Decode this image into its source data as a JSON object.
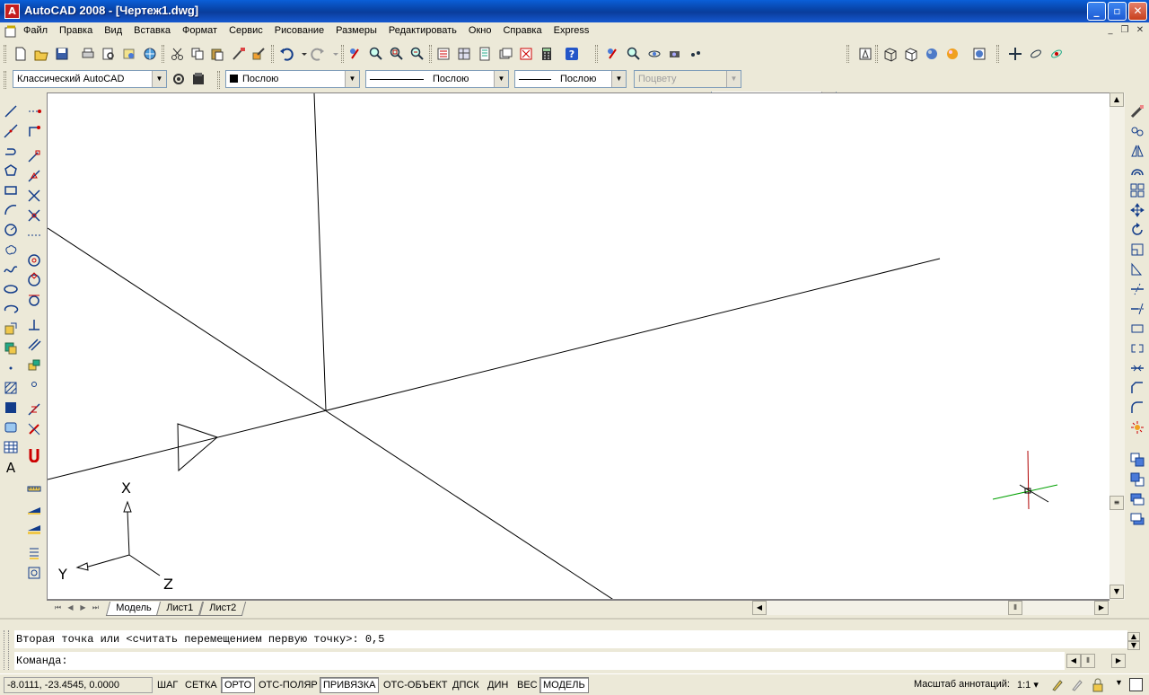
{
  "window": {
    "title": "AutoCAD 2008 - [Чертеж1.dwg]"
  },
  "menu": {
    "items": [
      "Файл",
      "Правка",
      "Вид",
      "Вставка",
      "Формат",
      "Сервис",
      "Рисование",
      "Размеры",
      "Редактировать",
      "Окно",
      "Справка",
      "Express"
    ]
  },
  "toolbar": {
    "workspace": "Классический AutoCAD",
    "color": "Послою",
    "linetype": "Послою",
    "lineweight": "Послою",
    "plotstyle": "Поцвету",
    "view_combo": ""
  },
  "viewport": {
    "ucs_x_label": "X",
    "ucs_y_label": "Y",
    "ucs_z_label": "Z",
    "crosshair_color": "#b00000",
    "crosshair_axis_color": "#00a000"
  },
  "layout_tabs": [
    "Модель",
    "Лист1",
    "Лист2"
  ],
  "command": {
    "history": "Вторая точка или <считать перемещением первую точку>: 0,5",
    "prompt": "Команда:"
  },
  "status": {
    "coords": "-8.0111, -23.4545, 0.0000",
    "toggles": [
      {
        "label": "ШАГ",
        "on": false
      },
      {
        "label": "СЕТКА",
        "on": false
      },
      {
        "label": "ОРТО",
        "on": true
      },
      {
        "label": "ОТС-ПОЛЯР",
        "on": false
      },
      {
        "label": "ПРИВЯЗКА",
        "on": true
      },
      {
        "label": "ОТС-ОБЪЕКТ",
        "on": false
      },
      {
        "label": "ДПСК",
        "on": false
      },
      {
        "label": "ДИН",
        "on": false
      },
      {
        "label": "ВЕС",
        "on": false
      },
      {
        "label": "МОДЕЛЬ",
        "on": true
      }
    ],
    "annotation_scale_label": "Масштаб аннотаций:",
    "annotation_scale_value": "1:1"
  }
}
